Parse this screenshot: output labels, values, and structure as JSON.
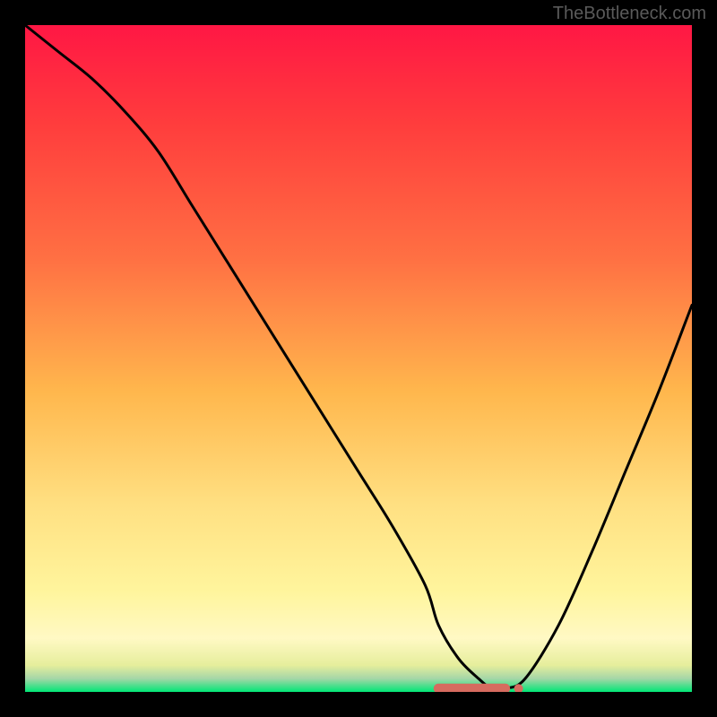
{
  "watermark": "TheBottleneck.com",
  "chart_data": {
    "type": "line",
    "title": "",
    "xlabel": "",
    "ylabel": "",
    "xlim": [
      0,
      100
    ],
    "ylim": [
      0,
      100
    ],
    "x": [
      0,
      5,
      10,
      15,
      20,
      25,
      30,
      35,
      40,
      45,
      50,
      55,
      60,
      62,
      65,
      68,
      70,
      72,
      75,
      80,
      85,
      90,
      95,
      100
    ],
    "values": [
      100,
      96,
      92,
      87,
      81,
      73,
      65,
      57,
      49,
      41,
      33,
      25,
      16,
      10,
      5,
      2,
      0.5,
      0.5,
      2,
      10,
      21,
      33,
      45,
      58
    ],
    "gradient_stops": [
      {
        "offset": 0,
        "color": "#ff1744"
      },
      {
        "offset": 15,
        "color": "#ff3d3d"
      },
      {
        "offset": 35,
        "color": "#ff7043"
      },
      {
        "offset": 55,
        "color": "#ffb74d"
      },
      {
        "offset": 72,
        "color": "#ffe082"
      },
      {
        "offset": 85,
        "color": "#fff59d"
      },
      {
        "offset": 92,
        "color": "#fff9c4"
      },
      {
        "offset": 96,
        "color": "#e6ee9c"
      },
      {
        "offset": 98,
        "color": "#a5d6a7"
      },
      {
        "offset": 100,
        "color": "#00e676"
      }
    ],
    "marker": {
      "x_start": 62,
      "x_end": 72,
      "y": 0.5,
      "color": "#d66b5f"
    },
    "line_color": "#000000",
    "border_color": "#000000"
  }
}
